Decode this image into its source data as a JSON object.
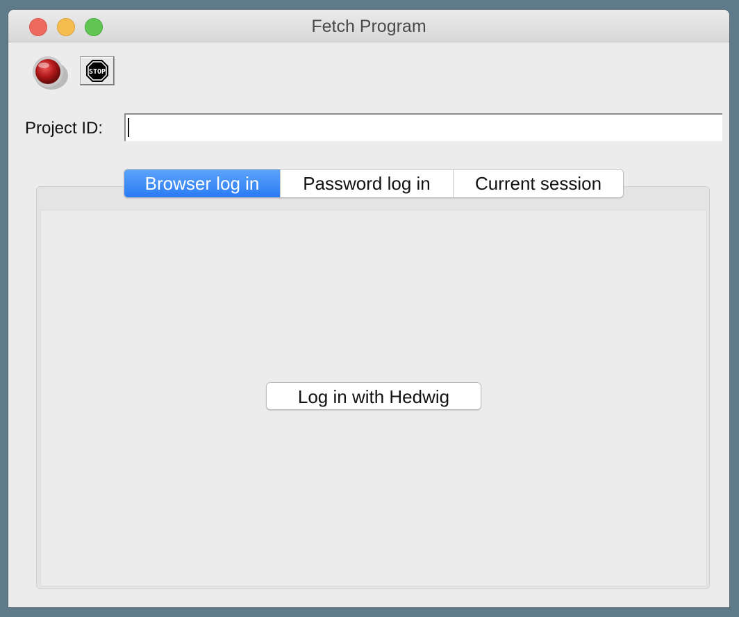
{
  "window": {
    "title": "Fetch Program",
    "controls": [
      "close",
      "minimize",
      "maximize"
    ]
  },
  "toolbar": {
    "record_icon": "red-record-button-icon",
    "stop_icon": "stop-sign-icon",
    "stop_glyph_text": "STOP"
  },
  "project": {
    "label": "Project ID:",
    "value": "",
    "placeholder": ""
  },
  "tabs": [
    {
      "label": "Browser log in",
      "active": true
    },
    {
      "label": "Password log in",
      "active": false
    },
    {
      "label": "Current session",
      "active": false
    }
  ],
  "panel": {
    "login_button_label": "Log in with Hedwig"
  },
  "colors": {
    "accent": "#2a7bf4",
    "background": "#ececec",
    "desktop": "#5f7b8a"
  }
}
